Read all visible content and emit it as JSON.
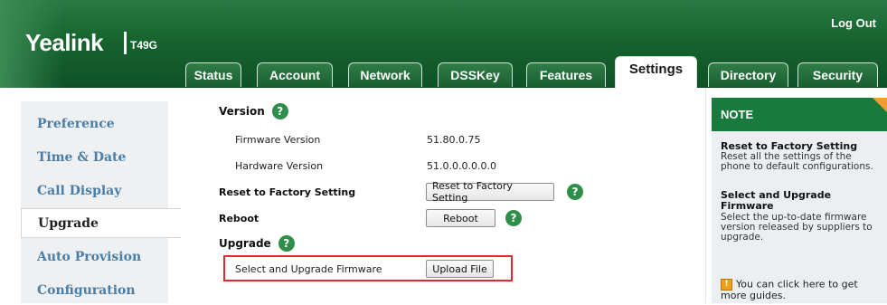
{
  "header": {
    "logo": "Yealink",
    "model": "T49G",
    "logout_label": "Log Out",
    "tabs": [
      {
        "label": "Status",
        "active": false
      },
      {
        "label": "Account",
        "active": false
      },
      {
        "label": "Network",
        "active": false
      },
      {
        "label": "DSSKey",
        "active": false
      },
      {
        "label": "Features",
        "active": false
      },
      {
        "label": "Settings",
        "active": true
      },
      {
        "label": "Directory",
        "active": false
      },
      {
        "label": "Security",
        "active": false
      }
    ]
  },
  "sidebar": {
    "items": [
      {
        "label": "Preference",
        "active": false
      },
      {
        "label": "Time & Date",
        "active": false
      },
      {
        "label": "Call Display",
        "active": false
      },
      {
        "label": "Upgrade",
        "active": true
      },
      {
        "label": "Auto Provision",
        "active": false
      },
      {
        "label": "Configuration",
        "active": false
      }
    ]
  },
  "main": {
    "version": {
      "title": "Version",
      "firmware_label": "Firmware Version",
      "firmware_value": "51.80.0.75",
      "hardware_label": "Hardware Version",
      "hardware_value": "51.0.0.0.0.0.0"
    },
    "reset": {
      "label": "Reset to Factory Setting",
      "button": "Reset to Factory Setting"
    },
    "reboot": {
      "label": "Reboot",
      "button": "Reboot"
    },
    "upgrade": {
      "title": "Upgrade",
      "select_label": "Select and Upgrade Firmware",
      "upload_button": "Upload File"
    },
    "help_glyph": "?"
  },
  "note": {
    "title": "NOTE",
    "items": [
      {
        "title": "Reset to Factory Setting",
        "text": "Reset all the settings of the phone to default configurations."
      },
      {
        "title": "Select and Upgrade Firmware",
        "text": "Select the up-to-date firmware version released by suppliers to upgrade."
      }
    ],
    "guide_icon": "!",
    "guide_text": "You can click here to get more guides."
  },
  "colors": {
    "header_green": "#17642f",
    "note_head": "#187a3c",
    "help_green": "#2f8f4a",
    "highlight_red": "#e0282e",
    "sidebar_link": "#4a7ea6"
  }
}
